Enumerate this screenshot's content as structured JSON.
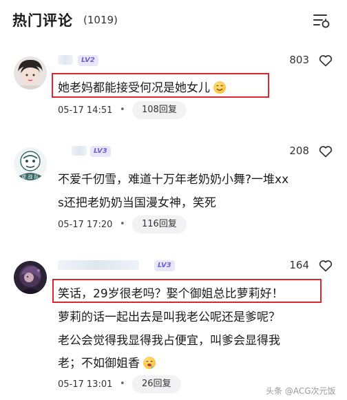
{
  "header": {
    "title": "热门评论",
    "count": "(1019)",
    "sort_icon": "sort-filter-icon"
  },
  "comments": [
    {
      "level": "LV2",
      "likes": "803",
      "lines": [
        "她老妈都能接受何况是她女儿"
      ],
      "emoji": "smiling-face",
      "date": "05-17 14:51",
      "replies": "108回复",
      "highlighted": true
    },
    {
      "level": "LV3",
      "likes": "208",
      "lines": [
        "不爱千仞雪，难道十万年老奶奶小舞?一堆xx",
        "s还把老奶奶当国漫女神，笑死"
      ],
      "date": "05-17 17:20",
      "replies": "116回复",
      "highlighted": false
    },
    {
      "level": "LV3",
      "likes": "164",
      "lines": [
        "笑话，29岁很老吗？娶个御姐总比萝莉好！",
        "萝莉的话一起出去是叫我老公呢还是爹呢？",
        "老公会觉得我显得我占便宜，叫爹会显得我",
        "老；不如御姐香"
      ],
      "emoji": "drooling-face",
      "date": "05-17 13:01",
      "replies": "26回复",
      "highlighted": true
    }
  ],
  "meta_separator": "•",
  "watermark": "头条 @ACG次元饭",
  "colors": {
    "highlight": "#d9272e",
    "level_badge": "#6f5fd8"
  }
}
